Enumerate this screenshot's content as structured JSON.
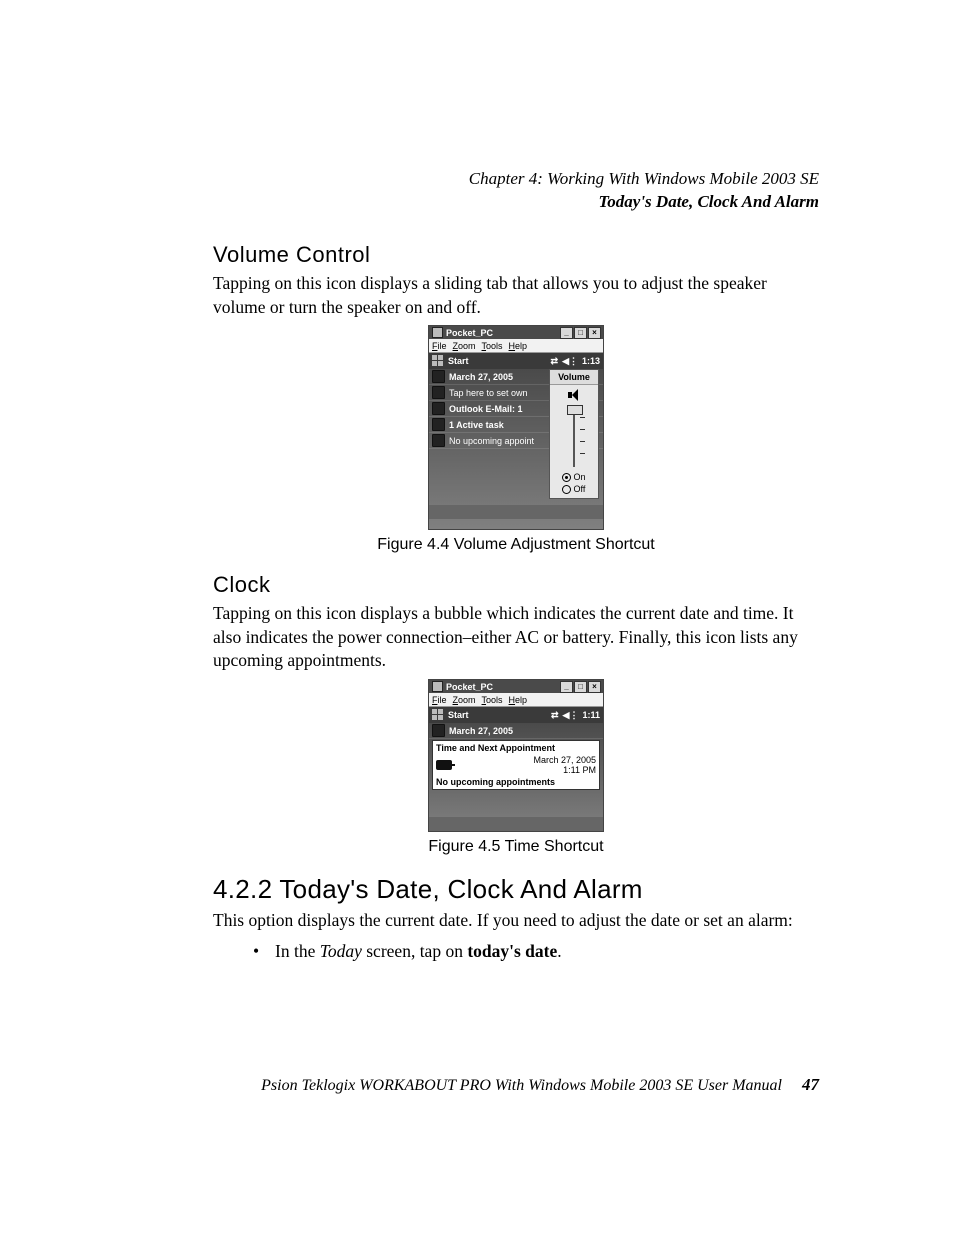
{
  "header": {
    "chapter": "Chapter  4:  Working With Windows Mobile 2003 SE",
    "section": "Today's Date, Clock And Alarm"
  },
  "sec_volume": {
    "heading": "Volume Control",
    "para": "Tapping on this icon displays a sliding tab that allows you to adjust the speaker volume or turn the speaker on and off."
  },
  "fig44": {
    "caption": "Figure 4.4 Volume Adjustment Shortcut",
    "window_title": "Pocket_PC",
    "menu": {
      "file": "File",
      "zoom": "Zoom",
      "tools": "Tools",
      "help": "Help"
    },
    "start": "Start",
    "clock": "1:13",
    "rows": {
      "date": "March 27, 2005",
      "owner": "Tap here to set own",
      "mail": "Outlook E-Mail: 1",
      "task": "1 Active task",
      "appt": "No upcoming appoint"
    },
    "popup": {
      "label": "Volume",
      "on": "On",
      "off": "Off"
    }
  },
  "sec_clock": {
    "heading": "Clock",
    "para": "Tapping on this icon displays a bubble which indicates the current date and time. It also indicates the power connection–either AC or battery. Finally, this icon lists any upcoming appointments."
  },
  "fig45": {
    "caption": "Figure 4.5 Time Shortcut",
    "window_title": "Pocket_PC",
    "menu": {
      "file": "File",
      "zoom": "Zoom",
      "tools": "Tools",
      "help": "Help"
    },
    "start": "Start",
    "clock": "1:11",
    "row_date": "March 27, 2005",
    "bubble": {
      "title": "Time and Next Appointment",
      "date": "March 27, 2005",
      "time": "1:11 PM",
      "noapt": "No upcoming appointments"
    }
  },
  "sec_422": {
    "heading": "4.2.2  Today's Date, Clock And Alarm",
    "para": "This option displays the current date. If you need to adjust the date or set an alarm:",
    "bullet_pre": "In the ",
    "bullet_ital": "Today",
    "bullet_mid": " screen, tap on ",
    "bullet_bold": "today's date",
    "bullet_post": "."
  },
  "footer": {
    "text": "Psion Teklogix WORKABOUT PRO With Windows Mobile 2003 SE User Manual",
    "page": "47"
  }
}
